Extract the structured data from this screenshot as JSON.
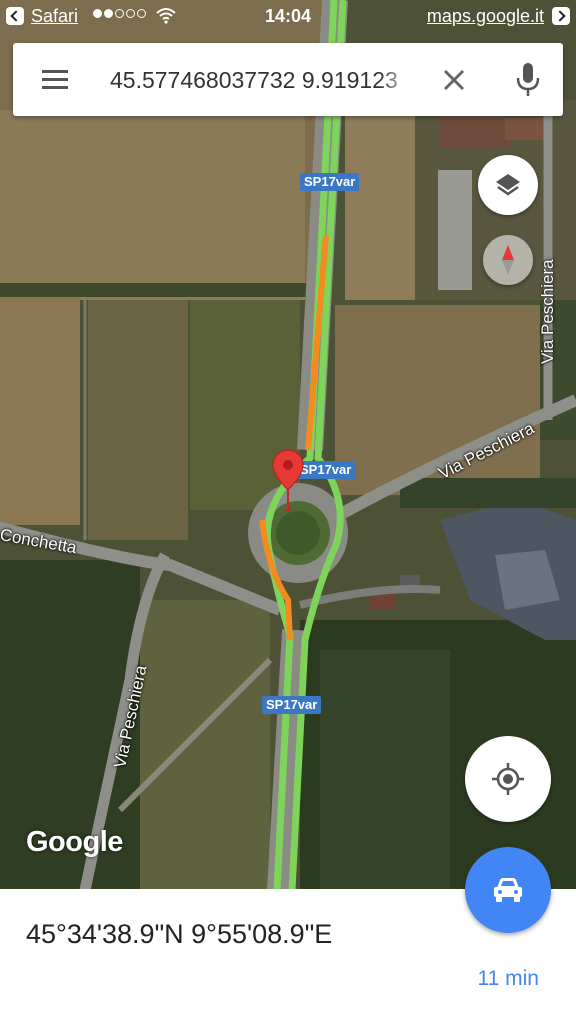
{
  "status_bar": {
    "back_app": "Safari",
    "time": "14:04",
    "url": "maps.google.it"
  },
  "search": {
    "query": "45.577468037732 9.919123"
  },
  "map": {
    "road_shields": [
      "SP17var",
      "SP17var",
      "SP17var"
    ],
    "streets": {
      "via_peschiera_east": "Via Peschiera",
      "via_peschiera_vertical": "Via Peschiera",
      "conchetta": "Conchetta",
      "via_peschiera_south": "Via Peschiera"
    },
    "logo": "Google",
    "traffic_colors": {
      "free": "#7ed35a",
      "slow": "#f28c1e"
    },
    "pin_color": "#e53935"
  },
  "place": {
    "coordinates": "45°34'38.9\"N 9°55'08.9\"E",
    "eta": "11 min"
  },
  "icons": [
    "menu-icon",
    "clear-icon",
    "mic-icon",
    "layers-icon",
    "compass-icon",
    "my-location-icon",
    "car-icon",
    "map-pin-icon"
  ]
}
